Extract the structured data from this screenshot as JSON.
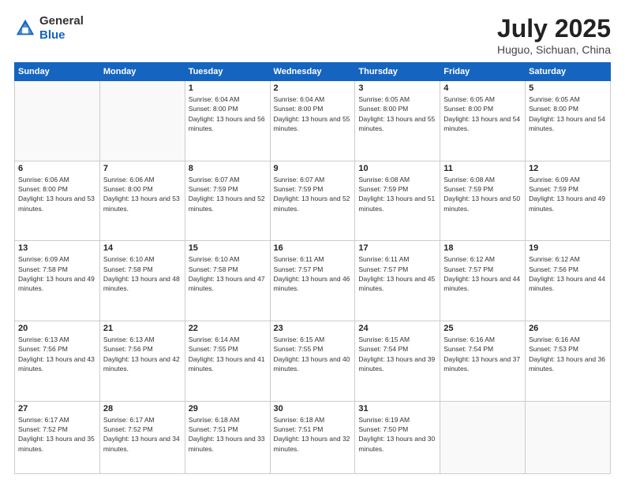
{
  "header": {
    "logo_general": "General",
    "logo_blue": "Blue",
    "title": "July 2025",
    "location": "Huguo, Sichuan, China"
  },
  "days_of_week": [
    "Sunday",
    "Monday",
    "Tuesday",
    "Wednesday",
    "Thursday",
    "Friday",
    "Saturday"
  ],
  "weeks": [
    [
      {
        "day": "",
        "empty": true
      },
      {
        "day": "",
        "empty": true
      },
      {
        "day": "1",
        "sunrise": "6:04 AM",
        "sunset": "8:00 PM",
        "daylight": "13 hours and 56 minutes."
      },
      {
        "day": "2",
        "sunrise": "6:04 AM",
        "sunset": "8:00 PM",
        "daylight": "13 hours and 55 minutes."
      },
      {
        "day": "3",
        "sunrise": "6:05 AM",
        "sunset": "8:00 PM",
        "daylight": "13 hours and 55 minutes."
      },
      {
        "day": "4",
        "sunrise": "6:05 AM",
        "sunset": "8:00 PM",
        "daylight": "13 hours and 54 minutes."
      },
      {
        "day": "5",
        "sunrise": "6:05 AM",
        "sunset": "8:00 PM",
        "daylight": "13 hours and 54 minutes."
      }
    ],
    [
      {
        "day": "6",
        "sunrise": "6:06 AM",
        "sunset": "8:00 PM",
        "daylight": "13 hours and 53 minutes."
      },
      {
        "day": "7",
        "sunrise": "6:06 AM",
        "sunset": "8:00 PM",
        "daylight": "13 hours and 53 minutes."
      },
      {
        "day": "8",
        "sunrise": "6:07 AM",
        "sunset": "7:59 PM",
        "daylight": "13 hours and 52 minutes."
      },
      {
        "day": "9",
        "sunrise": "6:07 AM",
        "sunset": "7:59 PM",
        "daylight": "13 hours and 52 minutes."
      },
      {
        "day": "10",
        "sunrise": "6:08 AM",
        "sunset": "7:59 PM",
        "daylight": "13 hours and 51 minutes."
      },
      {
        "day": "11",
        "sunrise": "6:08 AM",
        "sunset": "7:59 PM",
        "daylight": "13 hours and 50 minutes."
      },
      {
        "day": "12",
        "sunrise": "6:09 AM",
        "sunset": "7:59 PM",
        "daylight": "13 hours and 49 minutes."
      }
    ],
    [
      {
        "day": "13",
        "sunrise": "6:09 AM",
        "sunset": "7:58 PM",
        "daylight": "13 hours and 49 minutes."
      },
      {
        "day": "14",
        "sunrise": "6:10 AM",
        "sunset": "7:58 PM",
        "daylight": "13 hours and 48 minutes."
      },
      {
        "day": "15",
        "sunrise": "6:10 AM",
        "sunset": "7:58 PM",
        "daylight": "13 hours and 47 minutes."
      },
      {
        "day": "16",
        "sunrise": "6:11 AM",
        "sunset": "7:57 PM",
        "daylight": "13 hours and 46 minutes."
      },
      {
        "day": "17",
        "sunrise": "6:11 AM",
        "sunset": "7:57 PM",
        "daylight": "13 hours and 45 minutes."
      },
      {
        "day": "18",
        "sunrise": "6:12 AM",
        "sunset": "7:57 PM",
        "daylight": "13 hours and 44 minutes."
      },
      {
        "day": "19",
        "sunrise": "6:12 AM",
        "sunset": "7:56 PM",
        "daylight": "13 hours and 44 minutes."
      }
    ],
    [
      {
        "day": "20",
        "sunrise": "6:13 AM",
        "sunset": "7:56 PM",
        "daylight": "13 hours and 43 minutes."
      },
      {
        "day": "21",
        "sunrise": "6:13 AM",
        "sunset": "7:56 PM",
        "daylight": "13 hours and 42 minutes."
      },
      {
        "day": "22",
        "sunrise": "6:14 AM",
        "sunset": "7:55 PM",
        "daylight": "13 hours and 41 minutes."
      },
      {
        "day": "23",
        "sunrise": "6:15 AM",
        "sunset": "7:55 PM",
        "daylight": "13 hours and 40 minutes."
      },
      {
        "day": "24",
        "sunrise": "6:15 AM",
        "sunset": "7:54 PM",
        "daylight": "13 hours and 39 minutes."
      },
      {
        "day": "25",
        "sunrise": "6:16 AM",
        "sunset": "7:54 PM",
        "daylight": "13 hours and 37 minutes."
      },
      {
        "day": "26",
        "sunrise": "6:16 AM",
        "sunset": "7:53 PM",
        "daylight": "13 hours and 36 minutes."
      }
    ],
    [
      {
        "day": "27",
        "sunrise": "6:17 AM",
        "sunset": "7:52 PM",
        "daylight": "13 hours and 35 minutes."
      },
      {
        "day": "28",
        "sunrise": "6:17 AM",
        "sunset": "7:52 PM",
        "daylight": "13 hours and 34 minutes."
      },
      {
        "day": "29",
        "sunrise": "6:18 AM",
        "sunset": "7:51 PM",
        "daylight": "13 hours and 33 minutes."
      },
      {
        "day": "30",
        "sunrise": "6:18 AM",
        "sunset": "7:51 PM",
        "daylight": "13 hours and 32 minutes."
      },
      {
        "day": "31",
        "sunrise": "6:19 AM",
        "sunset": "7:50 PM",
        "daylight": "13 hours and 30 minutes."
      },
      {
        "day": "",
        "empty": true
      },
      {
        "day": "",
        "empty": true
      }
    ]
  ]
}
